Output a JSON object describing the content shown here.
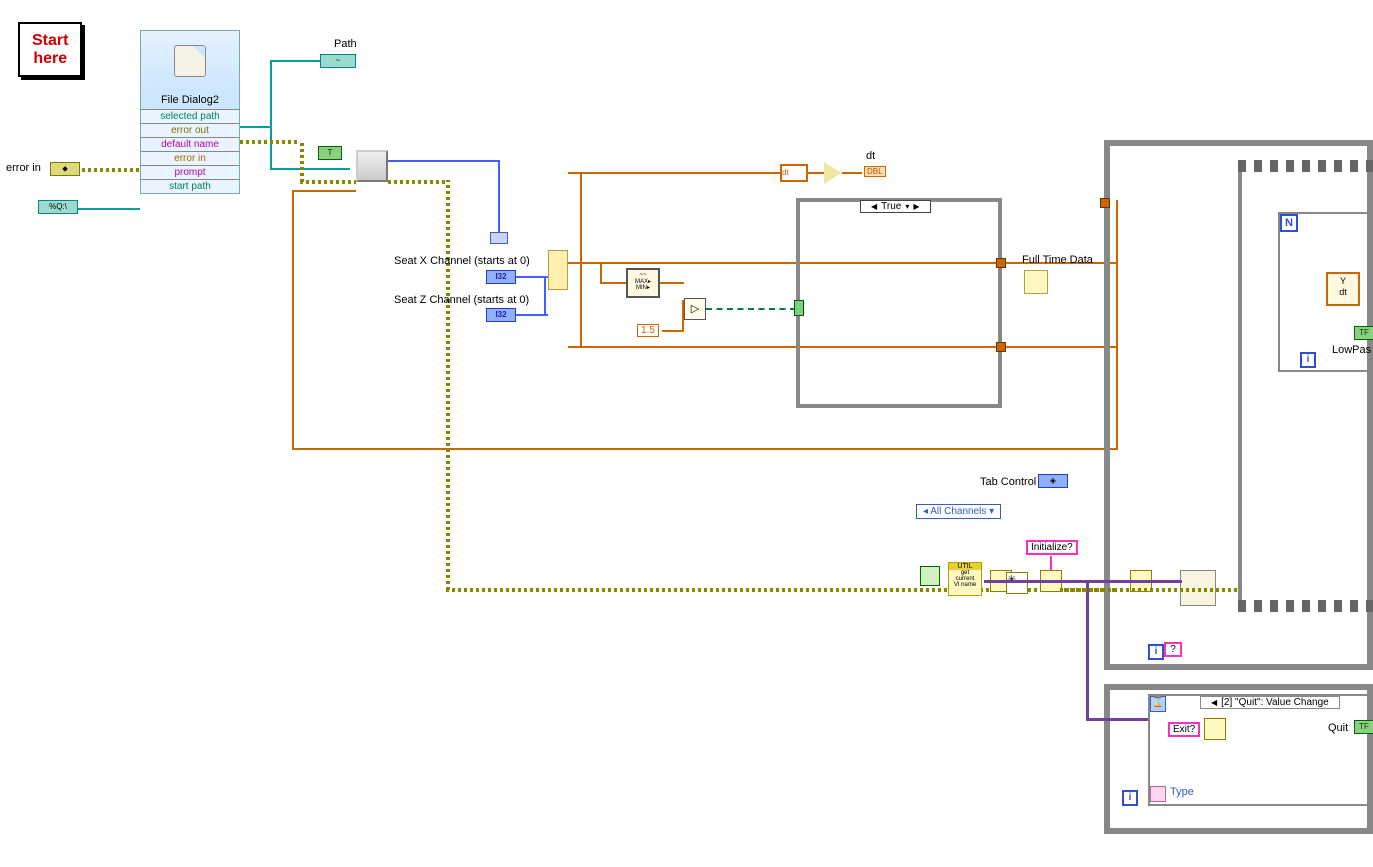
{
  "start_label_line1": "Start",
  "start_label_line2": "here",
  "file_dialog": {
    "title": "File Dialog2",
    "rows": {
      "selected_path": "selected path",
      "error_out": "error out",
      "default_name": "default name",
      "error_in": "error in",
      "prompt": "prompt",
      "start_path": "start path"
    }
  },
  "labels": {
    "error_in": "error in",
    "path": "Path",
    "seat_x": "Seat X Channel (starts at 0)",
    "seat_z": "Seat Z Channel (starts at 0)",
    "dt": "dt",
    "full_time_data": "Full Time Data",
    "tab_control": "Tab Control",
    "all_channels": "All Channels",
    "initialize": "Initialize?",
    "quit_case": "[2] \"Quit\": Value Change",
    "quit": "Quit",
    "exit": "Exit?",
    "type": "Type",
    "lowpass": "LowPas",
    "y": "Y",
    "dt2": "dt",
    "util": "UTIL\nget\ncurrent\nVI name"
  },
  "case_selector": "True",
  "constants": {
    "one_point_five": "1.5",
    "i32": "I32",
    "dbl": "DBL",
    "t": "T",
    "path_const": "%Q:\\",
    "tf": "TF"
  },
  "icon_names": {
    "n": "N",
    "i": "i",
    "maxmin": "~~\nMAX▸\nMIN▸",
    "gt": "▷",
    "question": "?",
    "dt_icon": "dt"
  }
}
